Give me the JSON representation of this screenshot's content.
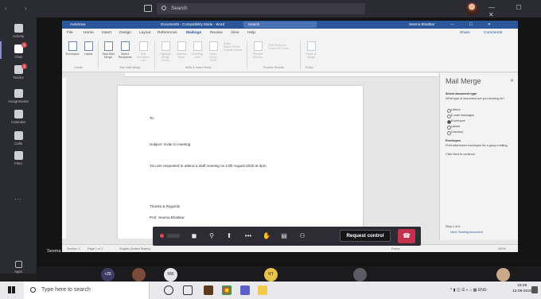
{
  "teams": {
    "search_placeholder": "Search",
    "rail": [
      {
        "label": "Activity",
        "icon": "bell-icon"
      },
      {
        "label": "Chat",
        "icon": "chat-icon",
        "badge": "1"
      },
      {
        "label": "Teams",
        "icon": "teams-icon",
        "badge": "1"
      },
      {
        "label": "Assignments",
        "icon": "assignments-icon"
      },
      {
        "label": "Calendar",
        "icon": "calendar-icon"
      },
      {
        "label": "Calls",
        "icon": "phone-icon"
      },
      {
        "label": "Files",
        "icon": "file-icon"
      }
    ],
    "more": "...",
    "apps_label": "Apps"
  },
  "word": {
    "autosave": "AutoSave",
    "doc_title": "Document5 - Compatibility Mode - Word",
    "search": "Search",
    "user": "Seema Bhattkar",
    "tabs": [
      "File",
      "Home",
      "Insert",
      "Design",
      "Layout",
      "References",
      "Mailings",
      "Review",
      "View",
      "Help"
    ],
    "active_tab": "Mailings",
    "share": "Share",
    "comments": "Comments",
    "ribbon": {
      "create": [
        {
          "label": "Envelopes"
        },
        {
          "label": "Labels"
        }
      ],
      "create_group": "Create",
      "start": [
        {
          "label": "Start Mail Merge"
        },
        {
          "label": "Select Recipients"
        },
        {
          "label": "Edit Recipient List"
        }
      ],
      "start_group": "Start Mail Merge",
      "write": [
        {
          "label": "Highlight Merge Fields"
        },
        {
          "label": "Address Block"
        },
        {
          "label": "Greeting Line"
        },
        {
          "label": "Insert Merge Field"
        }
      ],
      "write_small": [
        "Rules",
        "Match Fields",
        "Update Labels"
      ],
      "write_group": "Write & Insert Fields",
      "preview": [
        {
          "label": "Preview Results"
        }
      ],
      "preview_small": [
        "Find Recipient",
        "Check for Errors"
      ],
      "preview_group": "Preview Results",
      "finish": [
        {
          "label": "Finish & Merge"
        }
      ],
      "finish_group": "Finish"
    },
    "document": {
      "to": "To:",
      "subject": "Subject: invite to meeting",
      "body": "You are requested to attend a staff meeting on 13th August 2020 at 3pm.",
      "regards": "Thanks & Regards",
      "signature": "Prof. Seema Bhattkar"
    },
    "pane": {
      "title": "Mail Merge",
      "section": "Select document type",
      "question": "What type of document are you working on?",
      "options": [
        "Letters",
        "E-mail messages",
        "Envelopes",
        "Labels",
        "Directory"
      ],
      "selected": "Envelopes",
      "info_title": "Envelopes",
      "info_text": "Print addressed envelopes for a group mailing.",
      "info_next": "Click Next to continue.",
      "step": "Step 1 of 6",
      "next_link": "Next: Starting document"
    },
    "status": {
      "section": "Section: 1",
      "page": "Page 1 of 1",
      "language": "English (United States)",
      "focus": "Focus",
      "zoom": "100%"
    }
  },
  "meeting": {
    "request_control": "Request control",
    "presenter": "Seema Bhattkar",
    "participants": [
      "+26",
      "",
      "RW",
      "RT",
      "",
      ""
    ]
  },
  "taskbar": {
    "search_placeholder": "Type here to search",
    "lang": "ENG",
    "time": "18:29",
    "date": "13-08-2020"
  }
}
